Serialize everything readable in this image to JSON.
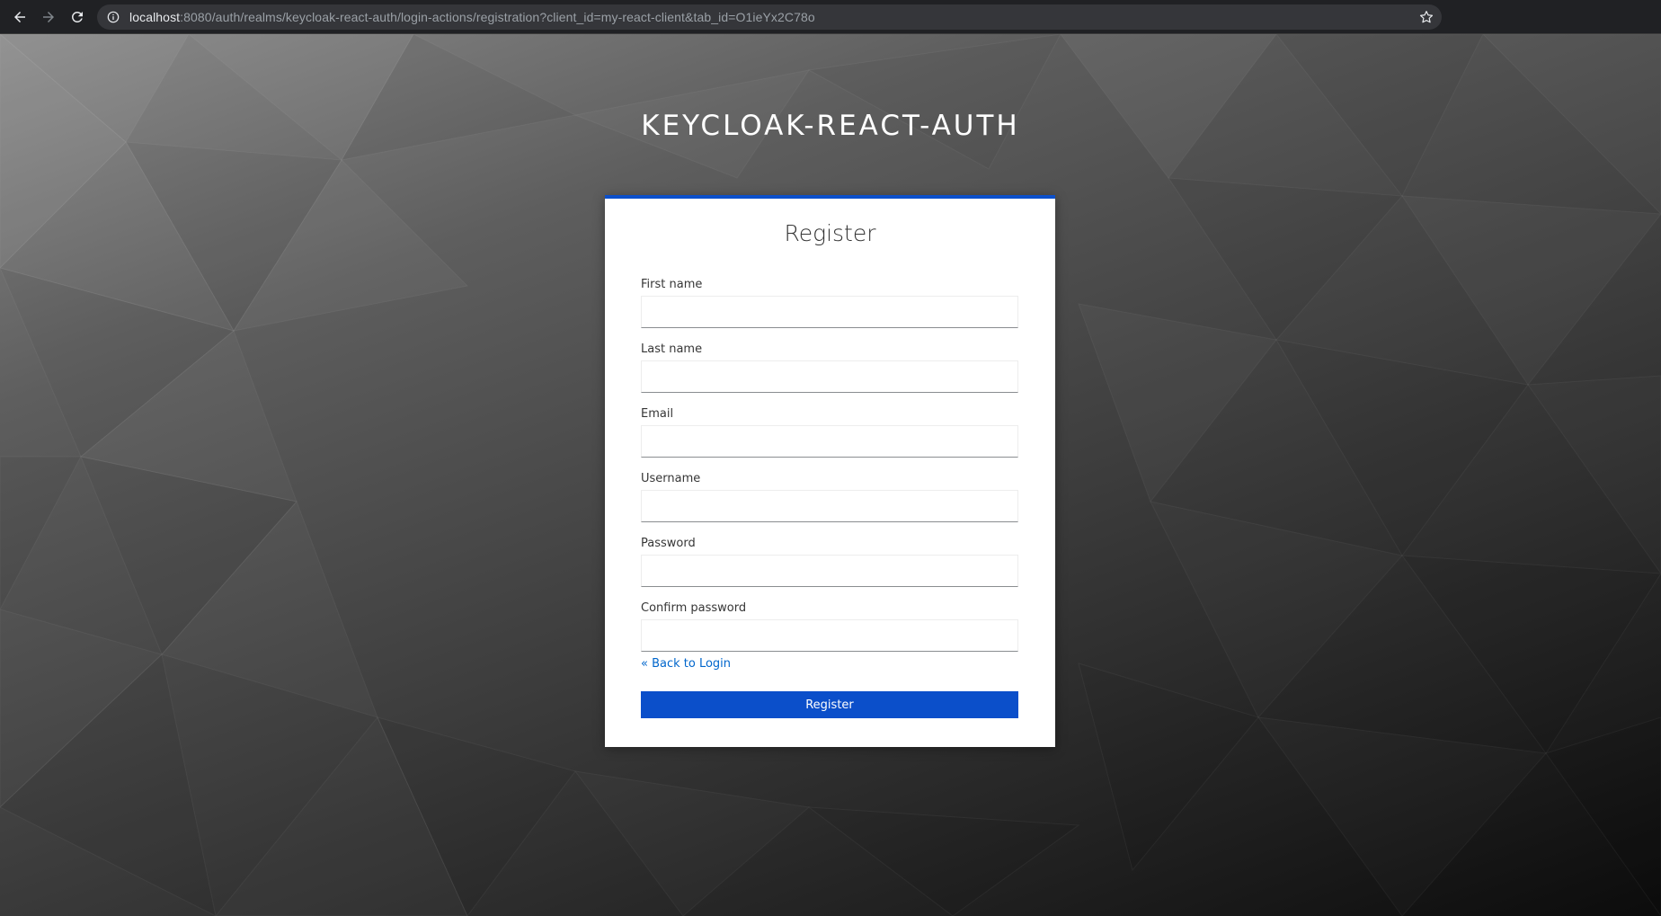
{
  "browser": {
    "url_host": "localhost",
    "url_rest": ":8080/auth/realms/keycloak-react-auth/login-actions/registration?client_id=my-react-client&tab_id=O1ieYx2C78o",
    "back_icon": "arrow-left-icon",
    "forward_icon": "arrow-right-icon",
    "reload_icon": "reload-icon",
    "info_icon": "info-icon",
    "bookmark_icon": "star-icon"
  },
  "page": {
    "realm_title": "KEYCLOAK-REACT-AUTH"
  },
  "form": {
    "title": "Register",
    "fields": {
      "first_name": {
        "label": "First name",
        "value": ""
      },
      "last_name": {
        "label": "Last name",
        "value": ""
      },
      "email": {
        "label": "Email",
        "value": ""
      },
      "username": {
        "label": "Username",
        "value": ""
      },
      "password": {
        "label": "Password",
        "value": ""
      },
      "confirm_password": {
        "label": "Confirm password",
        "value": ""
      }
    },
    "back_link": "« Back to Login",
    "submit_label": "Register"
  },
  "colors": {
    "accent": "#0b4fca",
    "link": "#0066cc",
    "browser_bar": "#202124"
  }
}
